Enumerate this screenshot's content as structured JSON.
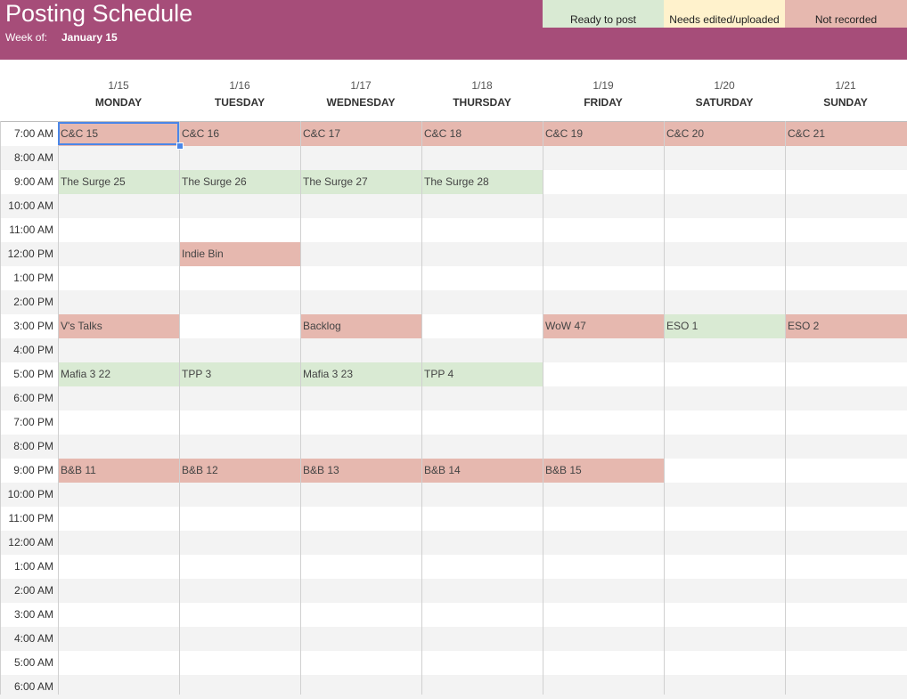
{
  "title": "Posting Schedule",
  "week": {
    "label": "Week of:",
    "value": "January 15"
  },
  "legend": [
    {
      "label": "Ready to post",
      "color": "#d9ead3"
    },
    {
      "label": "Needs edited/uploaded",
      "color": "#fff2cc"
    },
    {
      "label": "Not recorded",
      "color": "#e6b8af"
    }
  ],
  "colors": {
    "header": "#a64d79",
    "ready": "#d9ead3",
    "needs": "#fff2cc",
    "not_recorded": "#e6b8af"
  },
  "days": [
    {
      "date": "1/15",
      "name": "MONDAY"
    },
    {
      "date": "1/16",
      "name": "TUESDAY"
    },
    {
      "date": "1/17",
      "name": "WEDNESDAY"
    },
    {
      "date": "1/18",
      "name": "THURSDAY"
    },
    {
      "date": "1/19",
      "name": "FRIDAY"
    },
    {
      "date": "1/20",
      "name": "SATURDAY"
    },
    {
      "date": "1/21",
      "name": "SUNDAY"
    }
  ],
  "times": [
    "7:00 AM",
    "8:00 AM",
    "9:00 AM",
    "10:00 AM",
    "11:00 AM",
    "12:00 PM",
    "1:00 PM",
    "2:00 PM",
    "3:00 PM",
    "4:00 PM",
    "5:00 PM",
    "6:00 PM",
    "7:00 PM",
    "8:00 PM",
    "9:00 PM",
    "10:00 PM",
    "11:00 PM",
    "12:00 AM",
    "1:00 AM",
    "2:00 AM",
    "3:00 AM",
    "4:00 AM",
    "5:00 AM",
    "6:00 AM"
  ],
  "entries": [
    {
      "time": 0,
      "day": 0,
      "text": "C&C 15",
      "status": "not_recorded"
    },
    {
      "time": 0,
      "day": 1,
      "text": "C&C 16",
      "status": "not_recorded"
    },
    {
      "time": 0,
      "day": 2,
      "text": "C&C 17",
      "status": "not_recorded"
    },
    {
      "time": 0,
      "day": 3,
      "text": "C&C 18",
      "status": "not_recorded"
    },
    {
      "time": 0,
      "day": 4,
      "text": "C&C 19",
      "status": "not_recorded"
    },
    {
      "time": 0,
      "day": 5,
      "text": "C&C 20",
      "status": "not_recorded"
    },
    {
      "time": 0,
      "day": 6,
      "text": "C&C 21",
      "status": "not_recorded"
    },
    {
      "time": 2,
      "day": 0,
      "text": "The Surge 25",
      "status": "ready"
    },
    {
      "time": 2,
      "day": 1,
      "text": "The Surge 26",
      "status": "ready"
    },
    {
      "time": 2,
      "day": 2,
      "text": "The Surge 27",
      "status": "ready"
    },
    {
      "time": 2,
      "day": 3,
      "text": "The Surge 28",
      "status": "ready"
    },
    {
      "time": 5,
      "day": 1,
      "text": "Indie Bin",
      "status": "not_recorded"
    },
    {
      "time": 8,
      "day": 0,
      "text": "V's Talks",
      "status": "not_recorded"
    },
    {
      "time": 8,
      "day": 2,
      "text": "Backlog",
      "status": "not_recorded"
    },
    {
      "time": 8,
      "day": 4,
      "text": "WoW 47",
      "status": "not_recorded"
    },
    {
      "time": 8,
      "day": 5,
      "text": "ESO 1",
      "status": "ready"
    },
    {
      "time": 8,
      "day": 6,
      "text": "ESO 2",
      "status": "not_recorded"
    },
    {
      "time": 10,
      "day": 0,
      "text": "Mafia 3 22",
      "status": "ready"
    },
    {
      "time": 10,
      "day": 1,
      "text": "TPP 3",
      "status": "ready"
    },
    {
      "time": 10,
      "day": 2,
      "text": "Mafia 3 23",
      "status": "ready"
    },
    {
      "time": 10,
      "day": 3,
      "text": "TPP 4",
      "status": "ready"
    },
    {
      "time": 14,
      "day": 0,
      "text": "B&B 11",
      "status": "not_recorded"
    },
    {
      "time": 14,
      "day": 1,
      "text": "B&B 12",
      "status": "not_recorded"
    },
    {
      "time": 14,
      "day": 2,
      "text": "B&B 13",
      "status": "not_recorded"
    },
    {
      "time": 14,
      "day": 3,
      "text": "B&B 14",
      "status": "not_recorded"
    },
    {
      "time": 14,
      "day": 4,
      "text": "B&B 15",
      "status": "not_recorded"
    }
  ]
}
